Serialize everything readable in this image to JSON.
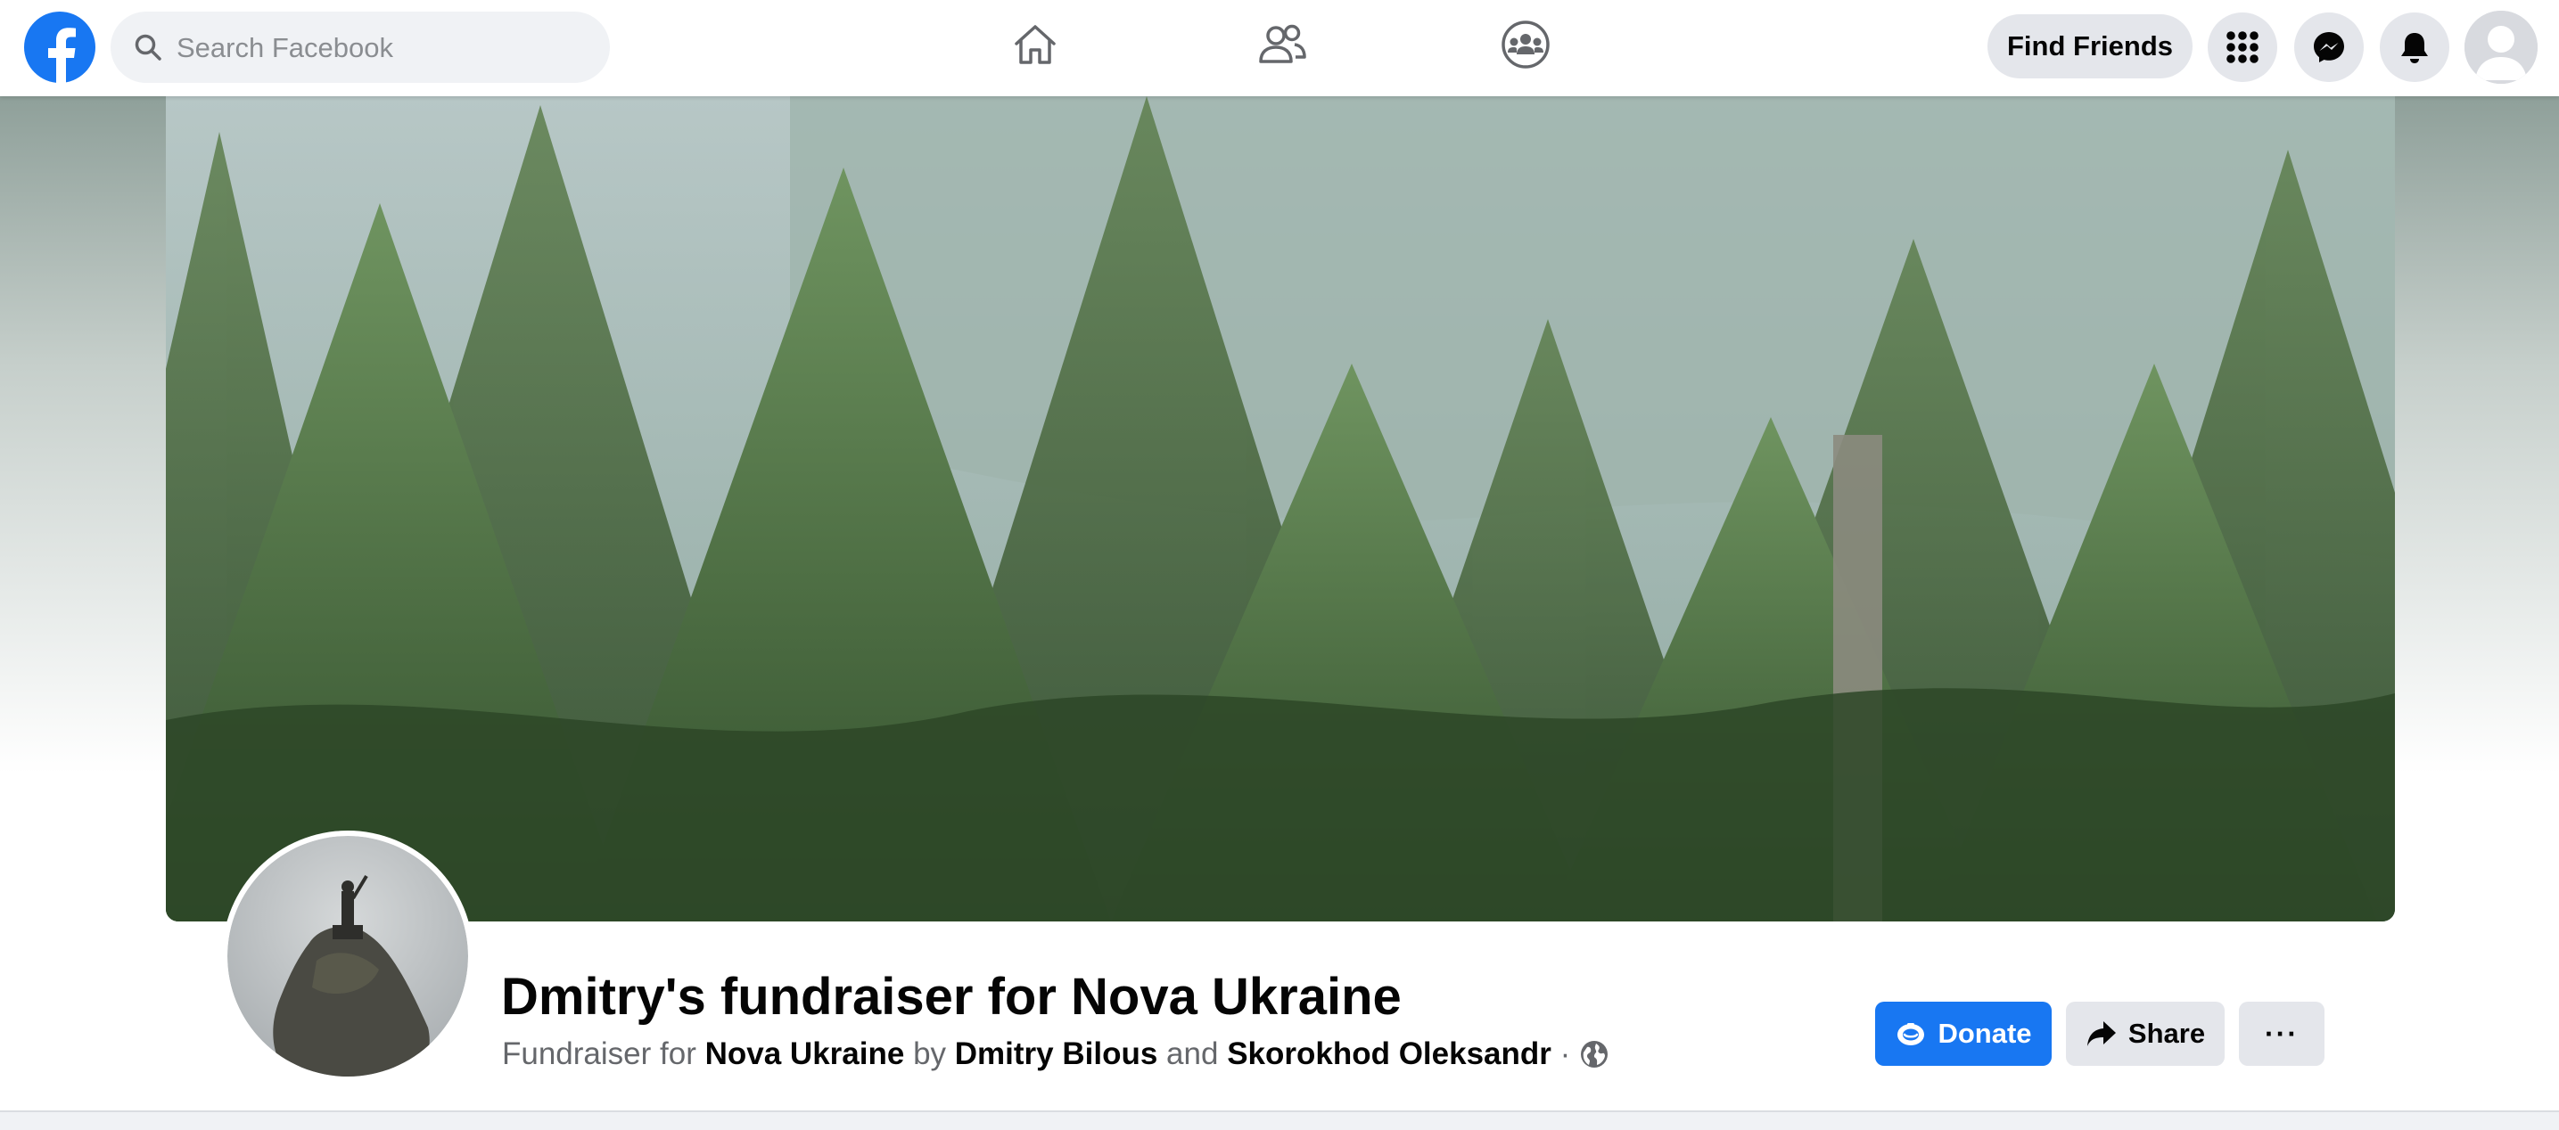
{
  "topbar": {
    "logo_icon": "facebook-logo-icon",
    "search": {
      "placeholder": "Search Facebook",
      "value": ""
    },
    "nav_icons": [
      "home-icon",
      "friends-icon",
      "groups-icon"
    ],
    "find_friends_label": "Find Friends",
    "right_icons": [
      "menu-grid-icon",
      "messenger-icon",
      "notifications-bell-icon",
      "account-avatar"
    ]
  },
  "fundraiser": {
    "title": "Dmitry's fundraiser for Nova Ukraine",
    "subtitle": {
      "prefix": "Fundraiser for",
      "organization": "Nova Ukraine",
      "by": "by",
      "organizer_1": "Dmitry Bilous",
      "and": "and",
      "organizer_2": "Skorokhod Oleksandr",
      "separator": "·",
      "privacy_icon": "globe-icon"
    },
    "actions": {
      "donate_label": "Donate",
      "share_label": "Share",
      "more_label": "···"
    }
  },
  "colors": {
    "brand": "#1877f2",
    "button_gray": "#e4e6eb",
    "text_primary": "#050505",
    "text_secondary": "#65676b"
  }
}
